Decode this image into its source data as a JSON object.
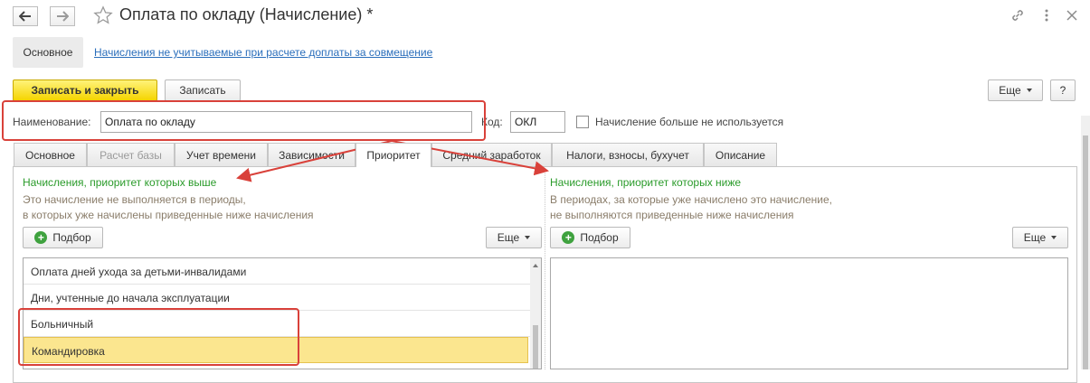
{
  "window": {
    "title": "Оплата по окладу (Начисление) *",
    "back_icon": "arrow-left-icon",
    "forward_icon": "arrow-right-icon",
    "favorite_icon": "star-icon",
    "link_icon": "link-icon",
    "menu_icon": "more-vertical-icon",
    "close_icon": "close-icon"
  },
  "sections": {
    "main": "Основное",
    "link": "Начисления не учитываемые при расчете доплаты за совмещение"
  },
  "toolbar": {
    "save_close": "Записать и закрыть",
    "save": "Записать",
    "more": "Еще",
    "help": "?"
  },
  "form": {
    "name_label": "Наименование:",
    "name_value": "Оплата по окладу",
    "code_label": "Код:",
    "code_value": "ОКЛ",
    "unused_label": "Начисление больше не используется"
  },
  "tabs": [
    {
      "label": "Основное"
    },
    {
      "label": "Расчет базы"
    },
    {
      "label": "Учет времени"
    },
    {
      "label": "Зависимости"
    },
    {
      "label": "Приоритет"
    },
    {
      "label": "Средний заработок"
    },
    {
      "label": "Налоги, взносы, бухучет"
    },
    {
      "label": "Описание"
    }
  ],
  "left_panel": {
    "heading": "Начисления, приоритет которых выше",
    "note_line1": "Это начисление не выполняется в периоды,",
    "note_line2": "в которых уже начислены приведенные ниже начисления",
    "pick_button": "Подбор",
    "more_button": "Еще",
    "items": [
      "Оплата дней ухода за детьми-инвалидами",
      "Дни, учтенные до начала эксплуатации",
      "Больничный",
      "Командировка"
    ]
  },
  "right_panel": {
    "heading": "Начисления, приоритет которых ниже",
    "note_line1": "В периодах, за которые уже начислено это начисление,",
    "note_line2": "не выполняются приведенные ниже начисления",
    "pick_button": "Подбор",
    "more_button": "Еще"
  },
  "colors": {
    "accent_yellow": "#f5d400",
    "highlight": "#fbe68f",
    "annotation_red": "#d9413a",
    "heading_green": "#2a9b2a",
    "link_blue": "#2a6ebb"
  }
}
